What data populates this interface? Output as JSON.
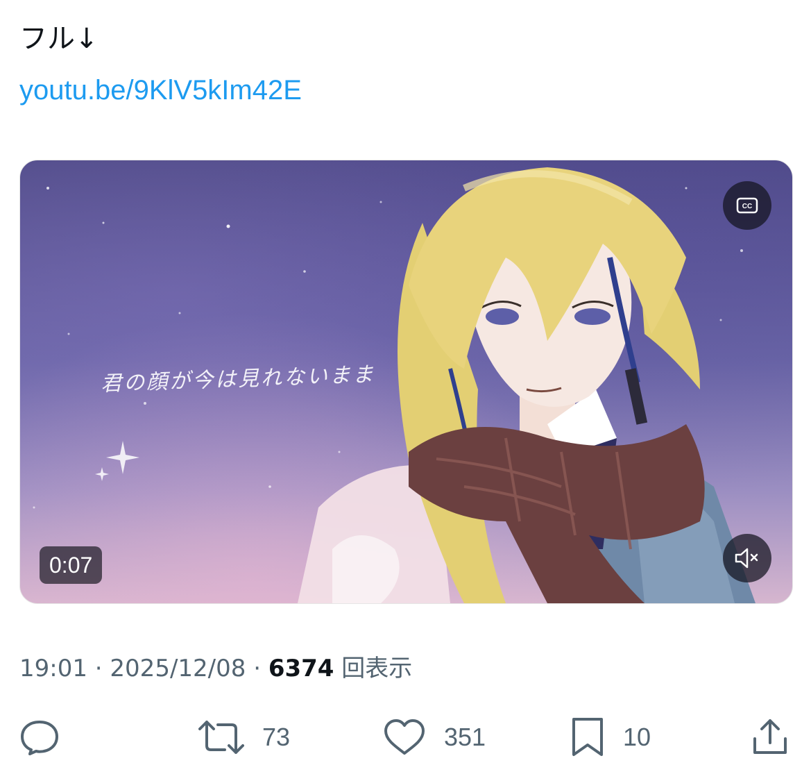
{
  "tweet": {
    "text": "フル↓",
    "link": "youtu.be/9KlV5kIm42E"
  },
  "media": {
    "lyric": "君の顔が今は見れないまま",
    "time": "0:07",
    "cc_label": "CC",
    "cc_icon": "closed-captions-icon",
    "mute_icon": "muted-speaker-icon"
  },
  "meta": {
    "time": "19:01",
    "separator": " · ",
    "date": "2025/12/08",
    "views_count": "6374",
    "views_label": "回表示"
  },
  "actions": {
    "reply_icon": "reply-icon",
    "retweet_icon": "retweet-icon",
    "retweet_count": "73",
    "like_icon": "heart-icon",
    "like_count": "351",
    "bookmark_icon": "bookmark-icon",
    "bookmark_count": "10",
    "share_icon": "share-icon"
  },
  "colors": {
    "link": "#1d9bf0",
    "secondary_text": "#536471",
    "primary_text": "#0f1419"
  }
}
